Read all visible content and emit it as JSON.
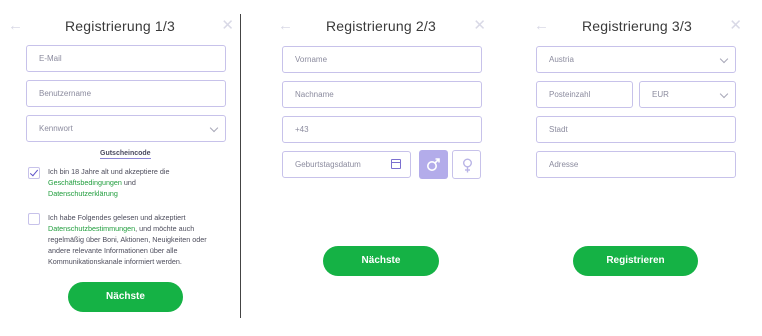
{
  "step1": {
    "title": "Registrierung 1/3",
    "back_icon": "arrow-left-icon",
    "close_icon": "close-icon",
    "email_placeholder": "E-Mail",
    "username_placeholder": "Benutzername",
    "password_placeholder": "Kennwort",
    "voucher_link": "Gutscheincode",
    "age_consent": {
      "text_before": "Ich bin 18 Jahre alt und akzeptiere die",
      "link_terms": "Geschäftsbedingungen",
      "text_and": " und",
      "link_privacy": "Datenschutzerklärung",
      "checked": true
    },
    "marketing_consent": {
      "text_before": "Ich habe Folgendes gelesen und akzeptiert",
      "link_privacy": "Datenschutzbestimmungen",
      "text_after": ", und möchte auch regelmäßig über Boni, Aktionen, Neuigkeiten oder andere relevante Informationen über alle Kommunikationskanale informiert werden.",
      "checked": false
    },
    "next_button": "Nächste"
  },
  "step2": {
    "title": "Registrierung 2/3",
    "firstname_placeholder": "Vorname",
    "lastname_placeholder": "Nachname",
    "phone_prefix": "+43",
    "birthdate_placeholder": "Geburtstagsdatum",
    "gender_selected": "male",
    "next_button": "Nächste"
  },
  "step3": {
    "title": "Registrierung 3/3",
    "country_value": "Austria",
    "postcode_placeholder": "Posteinzahl",
    "currency_value": "EUR",
    "city_placeholder": "Stadt",
    "address_placeholder": "Adresse",
    "register_button": "Registrieren"
  },
  "colors": {
    "accent_green": "#15b245",
    "field_border": "#c7c2ea",
    "male_selected": "#b3acea",
    "link_green": "#1f9d3c"
  }
}
